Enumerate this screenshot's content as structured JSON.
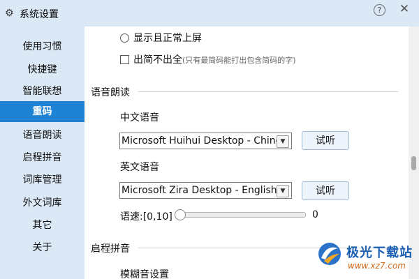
{
  "window": {
    "title": "系统设置",
    "help": "?",
    "close": "✕"
  },
  "sidebar": {
    "items": [
      {
        "label": "使用习惯"
      },
      {
        "label": "快捷键"
      },
      {
        "label": "智能联想"
      },
      {
        "label": "重码",
        "active": true
      },
      {
        "label": "语音朗读"
      },
      {
        "label": "启程拼音"
      },
      {
        "label": "词库管理"
      },
      {
        "label": "外文词库"
      },
      {
        "label": "其它"
      },
      {
        "label": "关于"
      }
    ]
  },
  "content": {
    "radio_option": {
      "label": "显示且正常上屏",
      "selected": false
    },
    "checkbox_option": {
      "label": "出简不出全",
      "note": "(只有最简码能打出包含简码的字)",
      "checked": false
    },
    "voice_section": {
      "title": "语音朗读",
      "chinese_voice_label": "中文语音",
      "chinese_voice_value": "Microsoft Huihui Desktop - Chinese",
      "english_voice_label": "英文语音",
      "english_voice_value": "Microsoft Zira Desktop - English",
      "listen_button": "试听",
      "speed_label": "语速:[0,10]",
      "speed_value": "0"
    },
    "pinyin_section": {
      "title": "启程拼音",
      "fuzzy_label": "模糊音设置"
    }
  },
  "watermark": {
    "name": "极光下载站",
    "url": "www.xz7.com"
  },
  "colors": {
    "accent": "#1e83d4",
    "sidebar_bg": "#dbe8f6"
  }
}
